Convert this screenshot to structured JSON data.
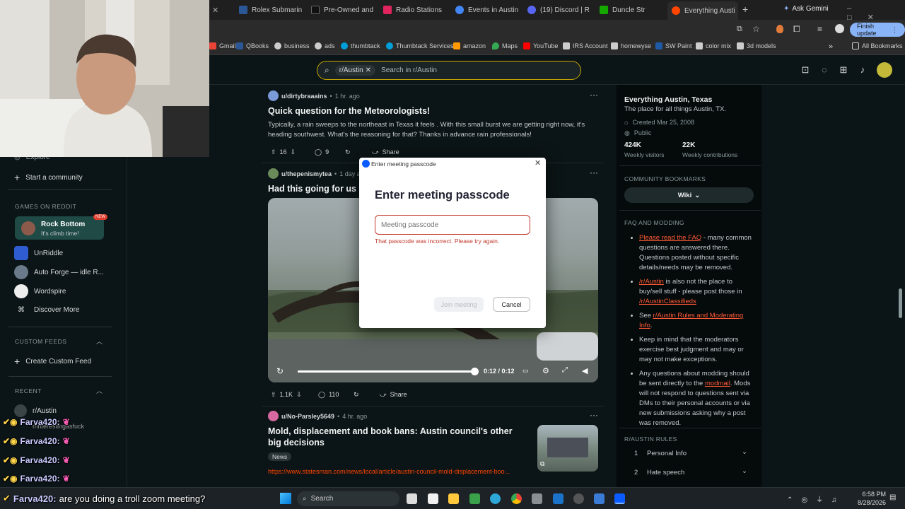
{
  "browser": {
    "tabs": [
      {
        "label": "Rolex Submarin",
        "color": "#2b5797"
      },
      {
        "label": "Pre-Owned and",
        "color": "#111111"
      },
      {
        "label": "Radio Stations",
        "color": "#e0245e"
      },
      {
        "label": "Events in Austin",
        "color": "#4285f4"
      },
      {
        "label": "(19) Discord | R",
        "color": "#5865f2"
      },
      {
        "label": "Duncle Str",
        "color": "#14a800"
      },
      {
        "label": "Everything Austi",
        "color": "#ff4500"
      }
    ],
    "ask_gemini": "Ask Gemini",
    "finish_update": "Finish update",
    "bookmarks": [
      "Gmail",
      "QBooks",
      "business",
      "ads",
      "thumbtack",
      "Thumbtack Services",
      "amazon",
      "Maps",
      "YouTube",
      "IRS Account",
      "homewyse",
      "SW Paint",
      "color mix",
      "3d models"
    ],
    "all_bookmarks": "All Bookmarks"
  },
  "search": {
    "chip": "r/Austin",
    "placeholder": "Search in r/Austin"
  },
  "leftnav": {
    "explore": "Explore",
    "start_community": "Start a community",
    "games_header": "GAMES ON REDDIT",
    "games": [
      {
        "name": "Rock Bottom",
        "sub": "It's climb time!",
        "badge": "NEW"
      },
      {
        "name": "UnRiddle"
      },
      {
        "name": "Auto Forge — idle R..."
      },
      {
        "name": "Wordspire"
      }
    ],
    "discover_more": "Discover More",
    "custom_feeds_header": "CUSTOM FEEDS",
    "create_custom_feed": "Create Custom Feed",
    "recent_header": "RECENT",
    "recent": [
      "r/Austin",
      "r/interestingasfuck"
    ]
  },
  "posts": [
    {
      "author": "u/dirtybraaains",
      "time": "1 hr. ago",
      "title": "Quick question for the Meteorologists!",
      "body": "Typically, a rain sweeps to the northeast in Texas it feels . With this small burst we are getting right now, it's heading southwest. What's the reasoning for that? Thanks in advance rain professionals!",
      "votes": "16",
      "comments": "9",
      "share": "Share"
    },
    {
      "author": "u/thepenismytea",
      "time": "1 day ago",
      "title": "Had this going for us in",
      "votes": "1.1K",
      "comments": "110",
      "share": "Share",
      "video_time": "0:12 / 0:12",
      "video_progress": 1.0
    },
    {
      "author": "u/No-Parsley5649",
      "time": "4 hr. ago",
      "title": "Mold, displacement and book bans: Austin council's other big decisions",
      "flair": "News",
      "link": "https://www.statesman.com/news/local/article/austin-council-mold-displacement-boo..."
    }
  ],
  "community": {
    "name": "Everything Austin, Texas",
    "tagline": "The place for all things Austin, TX.",
    "created": "Created Mar 25, 2008",
    "visibility": "Public",
    "visitors": "424K",
    "visitors_label": "Weekly visitors",
    "contributions": "22K",
    "contributions_label": "Weekly contributions",
    "bookmarks_header": "COMMUNITY BOOKMARKS",
    "wiki": "Wiki",
    "faq_header": "FAQ AND MODDING",
    "faq": {
      "b1_link": "Please read the FAQ",
      "b1_text": " - many common questions are answered there. Questions posted without specific details/needs may be removed.",
      "b2_link": "/r/Austin",
      "b2_text": " is also not the place to buy/sell stuff - please post those in ",
      "b2_link2": "/r/AustinClassifieds",
      "b3_pre": "See ",
      "b3_link": "r/Austin Rules and Moderating Info",
      "b3_post": ".",
      "b4_text": "Keep in mind that the moderators exercise best judgment and may or may not make exceptions.",
      "b5_pre": "Any questions about modding should be sent directly to the ",
      "b5_link": "modmail",
      "b5_post": ". Mods will not respond to questions sent via DMs to their personal accounts or via new submissions asking why a post was removed."
    },
    "rules_header": "R/AUSTIN RULES",
    "rules": [
      {
        "num": "1",
        "label": "Personal Info"
      },
      {
        "num": "2",
        "label": "Hate speech"
      }
    ]
  },
  "dialog": {
    "window_title": "Enter meeting passcode",
    "heading": "Enter meeting passcode",
    "placeholder": "Meeting passcode",
    "error": "That passcode was incorrect. Please try again.",
    "join": "Join meeting",
    "cancel": "Cancel"
  },
  "chat": {
    "user": "Farva420:",
    "message": "are you doing a troll zoom meeting?"
  },
  "taskbar": {
    "search": "Search",
    "time": "6:58 PM",
    "date": "8/28/2026"
  },
  "colors": {
    "accent": "#ff4500",
    "search_border": "#c7a600",
    "zoom_blue": "#0b5cff",
    "error_red": "#c0392b"
  }
}
